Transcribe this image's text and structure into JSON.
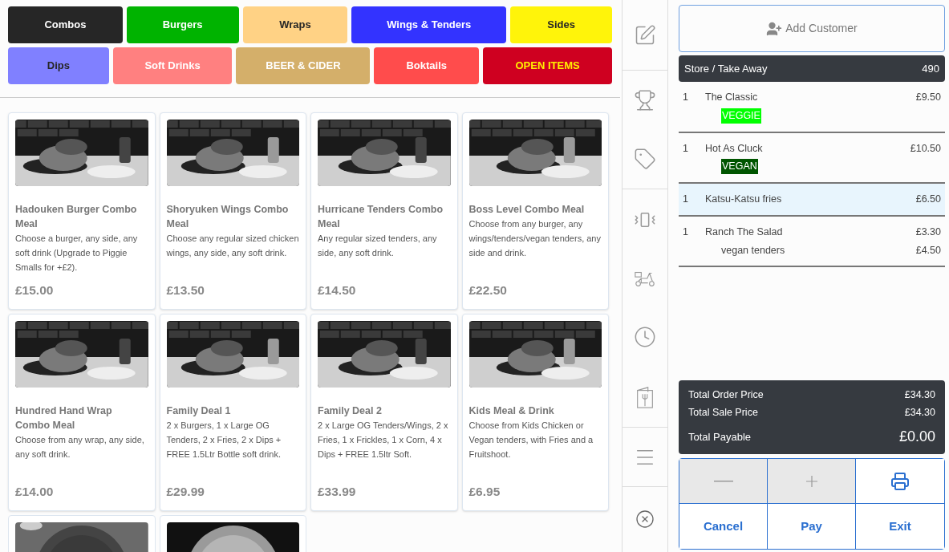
{
  "categories": [
    [
      {
        "kind": "light",
        "label": "Combos",
        "color": "#262626"
      },
      {
        "kind": "light",
        "label": "Burgers",
        "color": "#00b300"
      },
      {
        "kind": "dark",
        "label": "Wraps",
        "color": "#ffd285"
      },
      {
        "kind": "light",
        "label": "Wings & Tenders",
        "color": "#3333ff"
      },
      {
        "kind": "dark",
        "label": "Sides",
        "color": "#fff40a"
      }
    ],
    [
      {
        "kind": "dark",
        "label": "Dips",
        "color": "#8080ff"
      },
      {
        "kind": "light",
        "label": "Soft Drinks",
        "color": "#ff8080"
      },
      {
        "kind": "light",
        "label": "BEER & CIDER",
        "color": "#d4af6a"
      },
      {
        "kind": "light",
        "label": "Boktails",
        "color": "#ff4c4c"
      },
      {
        "kind": "open_items",
        "label": "OPEN ITEMS",
        "color": "#cf0020"
      }
    ]
  ],
  "products": [
    {
      "kind": "full",
      "name": "Hadouken Burger Combo Meal",
      "description": "Choose a burger, any side, any soft drink (Upgrade to Piggie Smalls for +£2).",
      "price": "£15.00"
    },
    {
      "kind": "full",
      "name": "Shoryuken Wings Combo Meal",
      "description": "Choose any regular sized chicken wings, any side, any soft drink.",
      "price": "£13.50"
    },
    {
      "kind": "full",
      "name": "Hurricane Tenders Combo Meal",
      "description": "Any regular sized tenders, any side, any soft drink.",
      "price": "£14.50"
    },
    {
      "kind": "full",
      "name": "Boss Level Combo Meal",
      "description": "Choose from any burger, any wings/tenders/vegan tenders, any side and drink.",
      "price": "£22.50"
    },
    {
      "kind": "full",
      "name": "Hundred Hand Wrap Combo Meal",
      "description": "Choose from any wrap, any side, any soft drink.",
      "price": "£14.00"
    },
    {
      "kind": "full",
      "name": "Family Deal 1",
      "description": "2 x Burgers, 1 x Large OG Tenders, 2 x Fries, 2 x Dips + FREE 1.5Ltr Bottle soft drink.",
      "price": "£29.99"
    },
    {
      "kind": "full",
      "name": "Family Deal 2",
      "description": "2 x Large OG Tenders/Wings, 2 x Fries, 1 x Frickles, 1 x Corn, 4 x Dips + FREE 1.5ltr Soft.",
      "price": "£33.99"
    },
    {
      "kind": "full",
      "name": "Kids Meal & Drink",
      "description": "Choose from Kids Chicken or Vegan tenders, with Fries and a Fruitshoot.",
      "price": "£6.95"
    },
    {
      "kind": "picture"
    },
    {
      "kind": "picture"
    }
  ],
  "order": {
    "add_customer": "Add Customer",
    "header": {
      "label": "Store / Take Away",
      "number": "490"
    },
    "lines": [
      {
        "qty": "1",
        "name": "The Classic",
        "price": "£9.50",
        "selected": false,
        "modifiers": [
          {
            "kind": "tag",
            "label": "VEGGIE",
            "color": "#00ff00"
          }
        ]
      },
      {
        "qty": "1",
        "name": "Hot As Cluck",
        "price": "£10.50",
        "selected": false,
        "modifiers": [
          {
            "kind": "tag",
            "label": "VEGAN",
            "color": "#005500"
          }
        ]
      },
      {
        "qty": "1",
        "name": "Katsu-Katsu fries",
        "price": "£6.50",
        "selected": true
      },
      {
        "qty": "1",
        "name": "Ranch The Salad",
        "price": "£3.30",
        "selected": false,
        "modifiers": [
          {
            "kind": "extra",
            "label": "vegan tenders",
            "price": "£4.50"
          }
        ]
      }
    ],
    "totals": [
      {
        "label": "Total Order Price",
        "value": "£34.30",
        "kind": "normal"
      },
      {
        "label": "Total Sale Price",
        "value": "£34.30",
        "kind": "normal"
      },
      {
        "label": "Total Payable",
        "value": "£0.00",
        "kind": "big"
      }
    ],
    "actions": [
      {
        "kind": "minus",
        "disabled": true
      },
      {
        "kind": "plus",
        "disabled": true
      },
      {
        "kind": "print",
        "disabled": false
      },
      {
        "kind": "text",
        "label": "Cancel",
        "disabled": false
      },
      {
        "kind": "text",
        "label": "Pay",
        "disabled": false
      },
      {
        "kind": "text",
        "label": "Exit",
        "disabled": false
      }
    ]
  }
}
